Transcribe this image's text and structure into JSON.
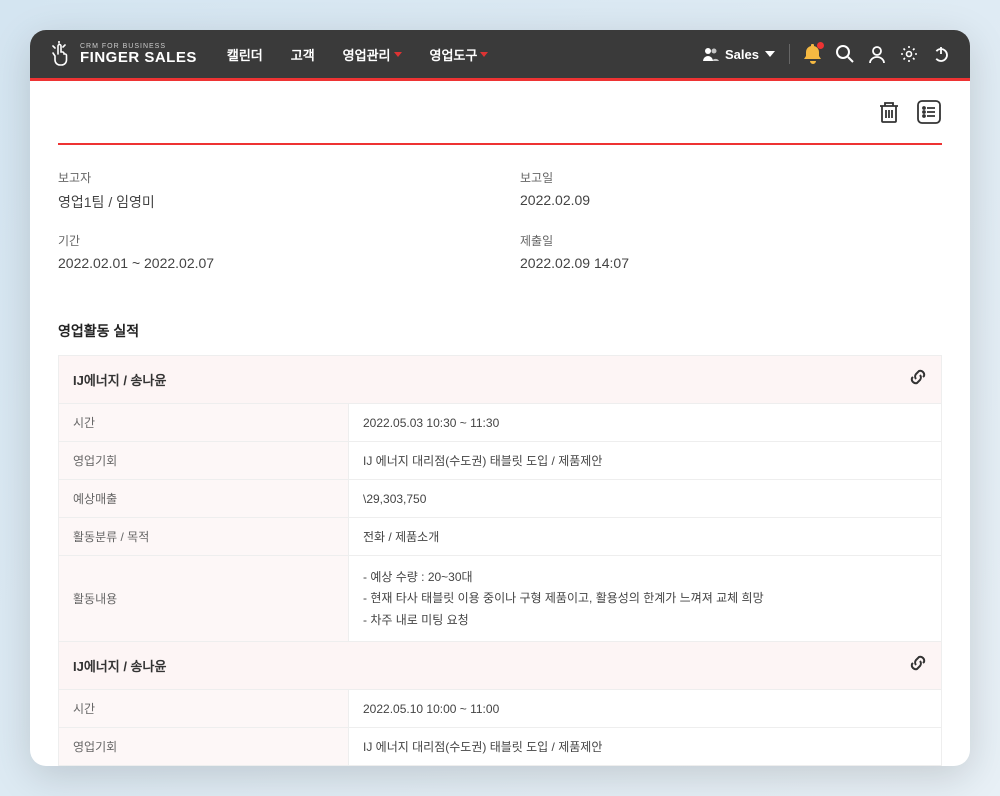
{
  "header": {
    "logo_sub": "CRM FOR BUSINESS",
    "logo_main": "FINGER SALES",
    "nav": [
      "캘린더",
      "고객",
      "영업관리",
      "영업도구"
    ],
    "user_label": "Sales"
  },
  "summary": {
    "reporter_label": "보고자",
    "reporter_value": "영업1팀 / 임영미",
    "report_date_label": "보고일",
    "report_date_value": "2022.02.09",
    "period_label": "기간",
    "period_value": "2022.02.01 ~ 2022.02.07",
    "submit_label": "제출일",
    "submit_value": "2022.02.09 14:07"
  },
  "section_title": "영업활동 실적",
  "activities": [
    {
      "header": "IJ에너지 / 송나윤",
      "rows": {
        "time_label": "시간",
        "time_value": "2022.05.03 10:30 ~ 11:30",
        "opp_label": "영업기회",
        "opp_value": "IJ 에너지 대리점(수도권) 태블릿 도입 / 제품제안",
        "rev_label": "예상매출",
        "rev_value": "\\29,303,750",
        "cat_label": "활동분류 / 목적",
        "cat_value": "전화 / 제품소개",
        "content_label": "활동내용",
        "content_lines": [
          "- 예상 수량 : 20~30대",
          "- 현재 타사 태블릿 이용 중이나 구형 제품이고, 활용성의 한계가 느껴져 교체 희망",
          "- 차주 내로 미팅 요청"
        ]
      }
    },
    {
      "header": "IJ에너지 / 송나윤",
      "rows": {
        "time_label": "시간",
        "time_value": "2022.05.10 10:00 ~ 11:00",
        "opp_label": "영업기회",
        "opp_value": "IJ 에너지 대리점(수도권) 태블릿 도입 / 제품제안"
      }
    }
  ]
}
